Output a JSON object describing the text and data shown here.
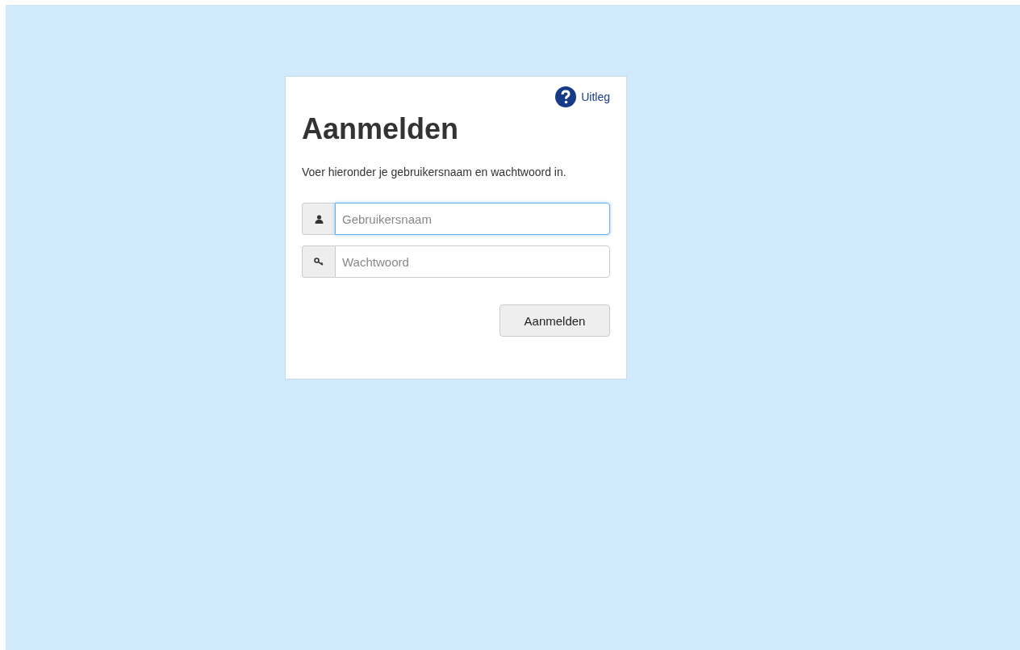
{
  "help_link": {
    "label": "Uitleg"
  },
  "title": "Aanmelden",
  "intro": "Voer hieronder je gebruikersnaam en wachtwoord in.",
  "fields": [
    {
      "kind": "user",
      "placeholder": "Gebruikersnaam",
      "focused": true
    },
    {
      "kind": "password",
      "placeholder": "Wachtwoord",
      "focused": false
    }
  ],
  "submit_button": "Aanmelden"
}
